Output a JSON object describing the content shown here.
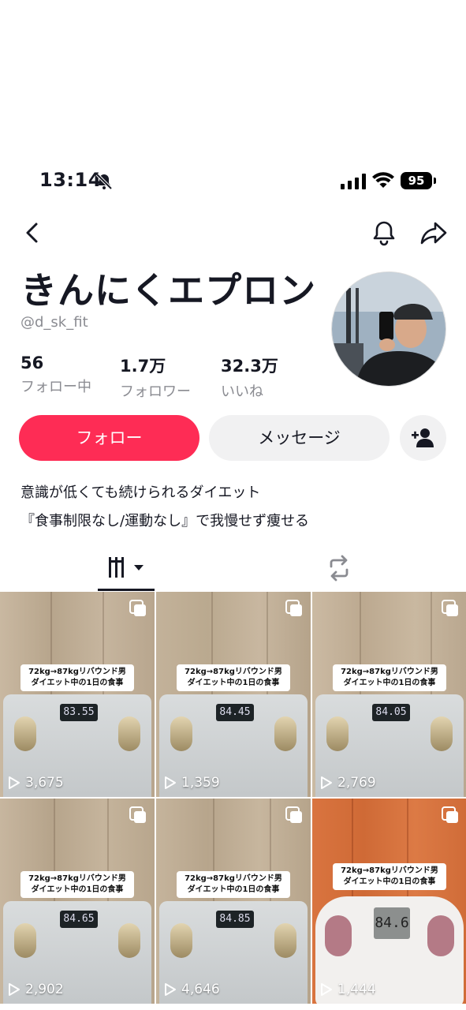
{
  "status_bar": {
    "time": "13:14",
    "battery": "95"
  },
  "profile": {
    "display_name": "きんにくエプロン",
    "username": "@d_sk_fit",
    "stats": [
      {
        "value": "56",
        "label": "フォロー中"
      },
      {
        "value": "1.7万",
        "label": "フォロワー"
      },
      {
        "value": "32.3万",
        "label": "いいね"
      }
    ],
    "bio": [
      "意識が低くても続けられるダイエット",
      "『食事制限なし/運動なし』で我慢せず痩せる"
    ]
  },
  "actions": {
    "follow_label": "フォロー",
    "message_label": "メッセージ"
  },
  "videos": [
    {
      "caption_line1": "72kg→87kgリバウンド男",
      "caption_line2": "ダイエット中の1日の食事",
      "scale_reading": "83.55",
      "views": "3,675"
    },
    {
      "caption_line1": "72kg→87kgリバウンド男",
      "caption_line2": "ダイエット中の1日の食事",
      "scale_reading": "84.45",
      "views": "1,359"
    },
    {
      "caption_line1": "72kg→87kgリバウンド男",
      "caption_line2": "ダイエット中の1日の食事",
      "scale_reading": "84.05",
      "views": "2,769"
    },
    {
      "caption_line1": "72kg→87kgリバウンド男",
      "caption_line2": "ダイエット中の1日の食事",
      "scale_reading": "84.65",
      "views": "2,902"
    },
    {
      "caption_line1": "72kg→87kgリバウンド男",
      "caption_line2": "ダイエット中の1日の食事",
      "scale_reading": "84.85",
      "views": "4,646"
    },
    {
      "caption_line1": "72kg→87kgリバウンド男",
      "caption_line2": "ダイエット中の1日の食事",
      "scale_reading": "84.6",
      "views": "1,444"
    }
  ],
  "colors": {
    "accent": "#fe2c55",
    "secondary_button": "#f1f1f2",
    "muted_text": "#8a8b91"
  }
}
